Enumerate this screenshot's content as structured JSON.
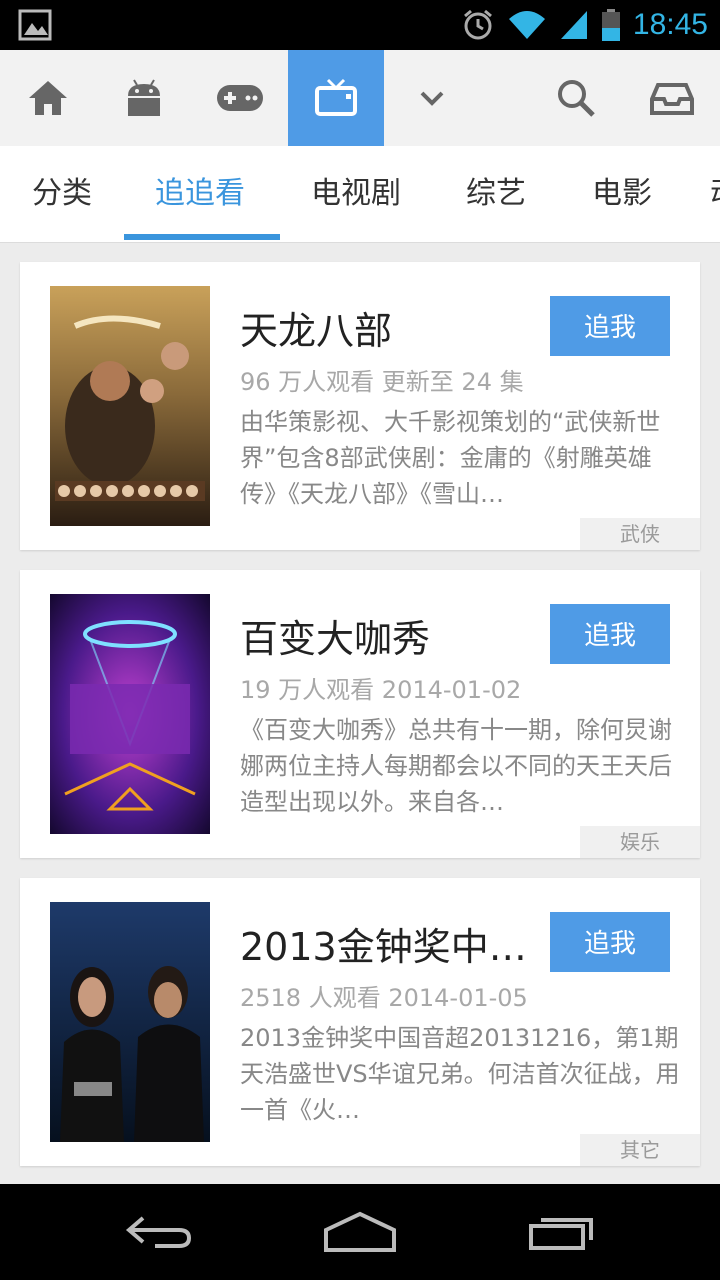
{
  "status_bar": {
    "time": "18:45",
    "icons": [
      "gallery-icon",
      "alarm-icon",
      "wifi-icon",
      "signal-icon",
      "battery-icon"
    ]
  },
  "action_bar": {
    "items": [
      {
        "icon": "home-icon"
      },
      {
        "icon": "android-icon"
      },
      {
        "icon": "gamepad-icon"
      },
      {
        "icon": "tv-icon",
        "active": true
      },
      {
        "icon": "chevron-down-icon"
      },
      {
        "icon": "search-icon"
      },
      {
        "icon": "inbox-icon"
      }
    ]
  },
  "tabs": [
    {
      "label": "分类"
    },
    {
      "label": "追追看",
      "active": true
    },
    {
      "label": "电视剧"
    },
    {
      "label": "综艺"
    },
    {
      "label": "电影"
    },
    {
      "label": "动"
    }
  ],
  "cards": [
    {
      "title": "天龙八部",
      "meta": "96 万人观看  更新至 24 集",
      "desc": "由华策影视、大千影视策划的“武侠新世界”包含8部武侠剧：金庸的《射雕英雄传》《天龙八部》《雪山…",
      "button": "追我",
      "tag": "武侠"
    },
    {
      "title": "百变大咖秀",
      "meta": "19 万人观看  2014-01-02",
      "desc": "《百变大咖秀》总共有十一期，除何炅谢娜两位主持人每期都会以不同的天王天后造型出现以外。来自各…",
      "button": "追我",
      "tag": "娱乐"
    },
    {
      "title": "2013金钟奖中…",
      "meta": "2518 人观看  2014-01-05",
      "desc": "2013金钟奖中国音超20131216，第1期天浩盛世VS华谊兄弟。何洁首次征战，用一首《火…",
      "button": "追我",
      "tag": "其它"
    }
  ],
  "nav_bar": {
    "items": [
      {
        "icon": "back-icon"
      },
      {
        "icon": "home-outline-icon"
      },
      {
        "icon": "recent-apps-icon"
      }
    ]
  },
  "colors": {
    "accent": "#4f9be6",
    "tab_active": "#3a95dd",
    "status_time": "#33b5e5"
  }
}
